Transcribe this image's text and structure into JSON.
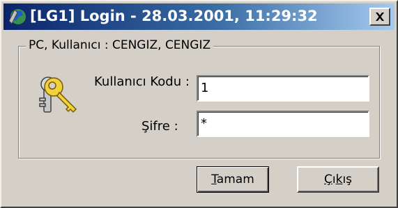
{
  "window": {
    "title": "[LG1] Login - 28.03.2001, 11:29:32",
    "close_glyph": "✕",
    "app_icon": "globe-icon",
    "titlebar_color": "#0a246a"
  },
  "group": {
    "legend": "PC, Kullanıcı : CENGIZ, CENGIZ",
    "icon": "keys-icon"
  },
  "fields": {
    "user_code": {
      "label": "Kullanıcı Kodu :",
      "value": "1"
    },
    "password": {
      "label": "Şifre :",
      "value": "*"
    }
  },
  "buttons": {
    "ok": {
      "label_first": "T",
      "label_rest": "amam"
    },
    "exit": {
      "label_first": "Ç",
      "label_mid": "ı",
      "label_under": "k",
      "label_rest": "ış"
    }
  }
}
